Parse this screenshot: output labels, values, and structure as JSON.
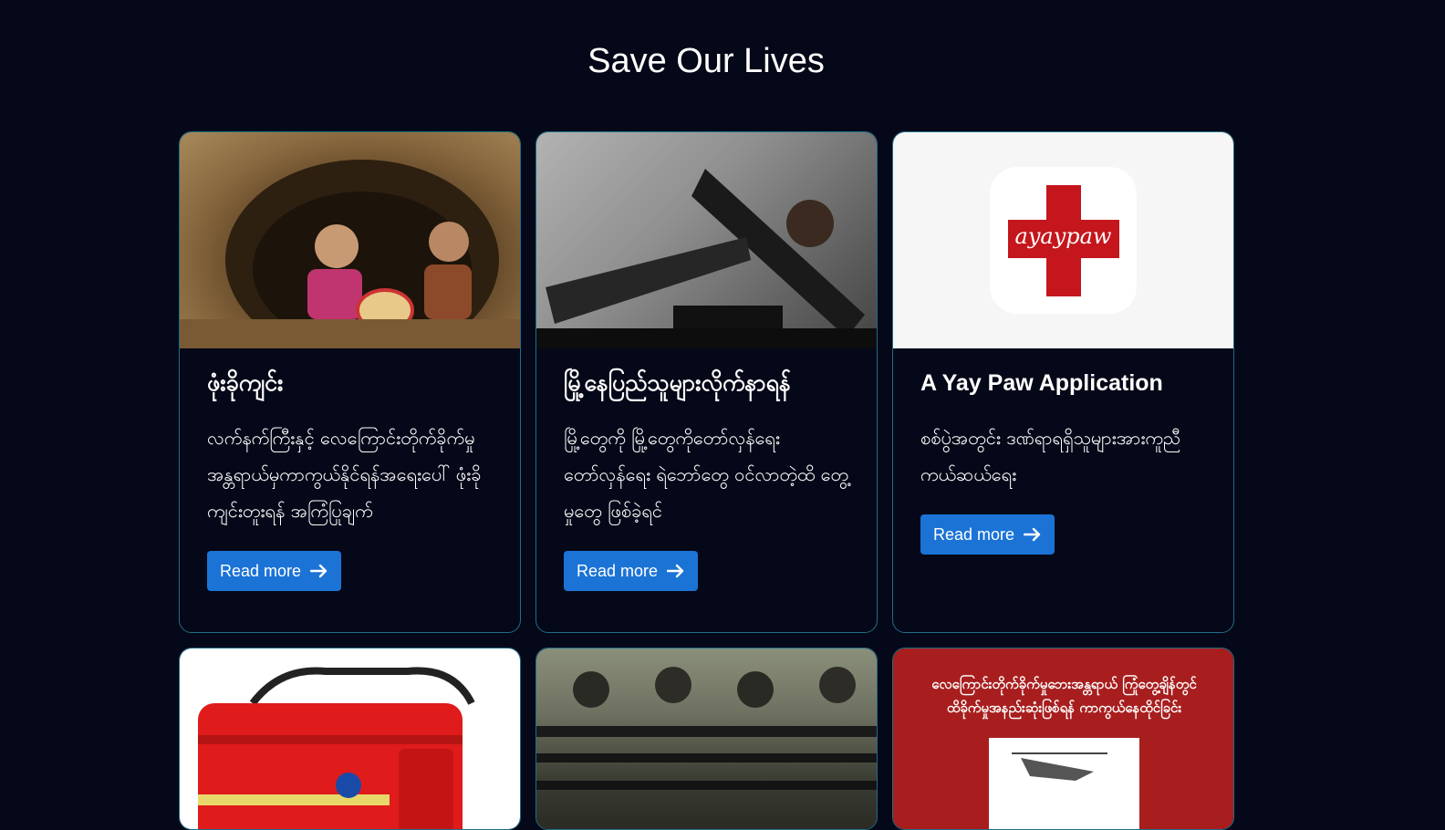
{
  "page": {
    "title": "Save Our Lives"
  },
  "cards": [
    {
      "title": "ဖုံးခိုကျင်း",
      "text": "လက်နက်ကြီးနှင့် လေကြောင်းတိုက်ခိုက်မှုအန္တရာယ်မှကာကွယ်နိုင်ရန်အရေးပေါ် ဖုံးခိုကျင်းတူးရန် အကြံပြုချက်",
      "button_label": "Read more",
      "image": "children-in-bunker"
    },
    {
      "title": "မြို့နေပြည်သူများလိုက်နာရန်",
      "text": "မြို့တွေကို မြို့တွေကိုတော်လှန်ရေး တော်လှန်ရေး ရဲဘော်တွေ ဝင်လာတဲ့ထိ တွေ့မှုတွေ ဖြစ်ခဲ့ရင်",
      "button_label": "Read more",
      "image": "rifle-from-vehicle"
    },
    {
      "title": "A Yay Paw Application",
      "text": "စစ်ပွဲအတွင်း ဒဏ်ရာရရှိသူများအားကူညီကယ်ဆယ်ရေး",
      "button_label": "Read more",
      "image": "ayaypaw-app-logo",
      "logo_text": "ayaypaw"
    },
    {
      "title": "",
      "text": "",
      "button_label": "",
      "image": "red-medical-bag"
    },
    {
      "title": "",
      "text": "",
      "button_label": "",
      "image": "soldiers-with-rifles"
    },
    {
      "title": "",
      "text": "",
      "button_label": "",
      "image": "airstrike-poster",
      "poster_text": "လေကြောင်းတိုက်ခိုက်မှုဘေးအန္တရာယ် ကြုံတွေ့ချိန်တွင် ထိခိုက်မှုအနည်းဆုံးဖြစ်ရန် ကာကွယ်နေထိုင်ခြင်း"
    }
  ],
  "icons": {
    "read_more_arrow": "arrow-right-icon"
  },
  "colors": {
    "background": "#050818",
    "card_border": "#1f6e86",
    "button": "#1b73d6",
    "logo_red": "#c4161c",
    "poster_red": "#a81e1e"
  }
}
